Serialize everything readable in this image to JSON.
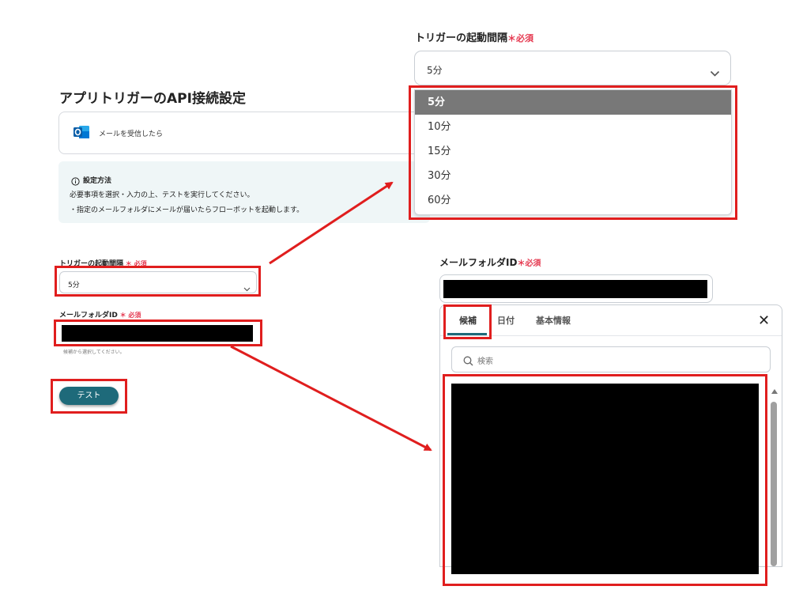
{
  "left_panel": {
    "title": "アプリトリガーのAPI接続設定",
    "app_card": {
      "icon": "outlook-icon",
      "label": "メールを受信したら"
    },
    "info": {
      "heading": "設定方法",
      "line1": "必要事項を選択・入力の上、テストを実行してください。",
      "line2": "・指定のメールフォルダにメールが届いたらフローボットを起動します。"
    },
    "trigger_interval": {
      "label": "トリガーの起動間隔",
      "required": "必須",
      "value": "5分"
    },
    "mail_folder": {
      "label": "メールフォルダID",
      "required": "必須",
      "hint": "候補から選択してください。"
    },
    "test_button": "テスト"
  },
  "right_top": {
    "label": "トリガーの起動間隔",
    "required_mark": "＊",
    "required": "必須",
    "selected": "5分",
    "options": [
      "5分",
      "10分",
      "15分",
      "30分",
      "60分"
    ]
  },
  "right_bottom": {
    "label": "メールフォルダID",
    "required_mark": "＊",
    "required": "必須",
    "tabs": [
      "候補",
      "日付",
      "基本情報"
    ],
    "active_tab": "候補",
    "search_placeholder": "検索",
    "close": "✕"
  },
  "colors": {
    "annotation": "#e01e1e",
    "required": "#e53950",
    "button": "#1e6a7a"
  }
}
